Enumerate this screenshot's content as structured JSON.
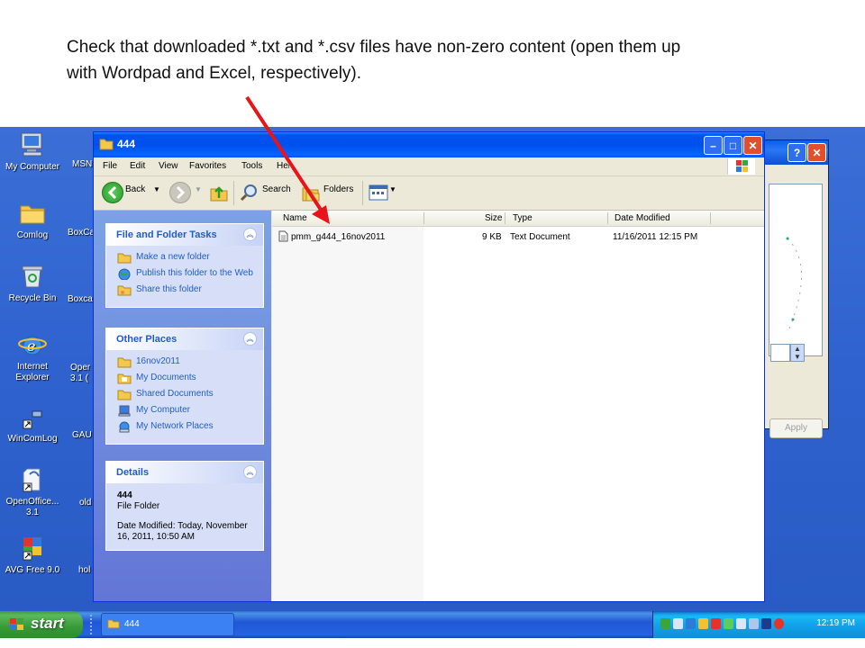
{
  "caption": {
    "line1": "Check that downloaded *.txt and *.csv files have non-zero content (open them up",
    "line2": "with Wordpad and Excel, respectively)."
  },
  "desktop_icons": [
    {
      "label": "My Computer",
      "icon": "my-computer-icon"
    },
    {
      "label": "Comlog",
      "icon": "folder-icon"
    },
    {
      "label": "Recycle Bin",
      "icon": "recycle-bin-icon"
    },
    {
      "label": "Internet Explorer",
      "icon": "internet-explorer-icon"
    },
    {
      "label": "WinComLog",
      "icon": "shortcut-icon"
    },
    {
      "label": "OpenOffice... 3.1",
      "icon": "openoffice-icon"
    },
    {
      "label": "AVG Free 9.0",
      "icon": "avg-icon"
    }
  ],
  "desktop_partial_labels": [
    "MSN",
    "BoxCa",
    "Boxca",
    "Oper 3.1 (",
    "GAU",
    "old",
    "hol"
  ],
  "window": {
    "title": "444",
    "menu": [
      "File",
      "Edit",
      "View",
      "Favorites",
      "Tools",
      "Help"
    ],
    "toolbar": {
      "back": "Back",
      "search": "Search",
      "folders": "Folders"
    },
    "file_tasks": {
      "title": "File and Folder Tasks",
      "items": [
        "Make a new folder",
        "Publish this folder to the Web",
        "Share this folder"
      ]
    },
    "other_places": {
      "title": "Other Places",
      "items": [
        "16nov2011",
        "My Documents",
        "Shared Documents",
        "My Computer",
        "My Network Places"
      ]
    },
    "details": {
      "title": "Details",
      "name": "444",
      "kind": "File Folder",
      "modified": "Date Modified: Today, November 16, 2011, 10:50 AM"
    },
    "columns": {
      "name": "Name",
      "size": "Size",
      "type": "Type",
      "date": "Date Modified"
    },
    "files": [
      {
        "name": "pmm_g444_16nov2011",
        "size": "9 KB",
        "type": "Text Document",
        "date": "11/16/2011 12:15 PM"
      }
    ]
  },
  "background_window": {
    "apply": "Apply"
  },
  "taskbar": {
    "start": "start",
    "task": "444",
    "clock": "12:19 PM"
  },
  "colors": {
    "annotation_arrow": "#e8141a",
    "desktop": "#3466d3",
    "titlebar": "#0054e3",
    "task_link": "#215dc6"
  }
}
